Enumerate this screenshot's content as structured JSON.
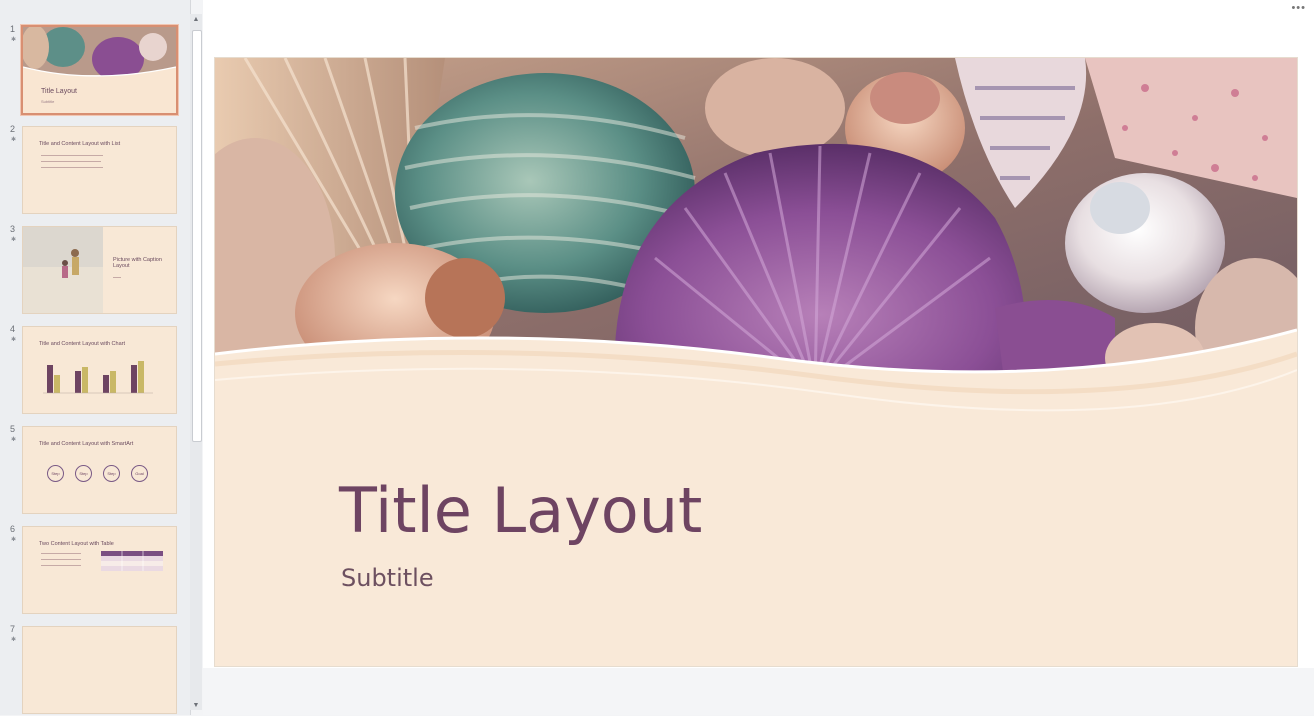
{
  "slides": [
    {
      "number": "1",
      "title": "Title Layout",
      "subtitle": "Subtitle"
    },
    {
      "number": "2",
      "title": "Title and Content Layout with List"
    },
    {
      "number": "3",
      "title": "Picture with Caption Layout"
    },
    {
      "number": "4",
      "title": "Title and Content Layout with Chart"
    },
    {
      "number": "5",
      "title": "Title and Content Layout with SmartArt",
      "smartart": [
        "Step",
        "Step",
        "Step",
        "Goal"
      ]
    },
    {
      "number": "6",
      "title": "Two Content Layout with Table"
    },
    {
      "number": "7",
      "title": ""
    }
  ],
  "current_slide": {
    "title": "Title Layout",
    "subtitle": "Subtitle"
  },
  "icons": {
    "more": "ellipsis-icon",
    "star": "animation-star-icon",
    "scroll_up": "scroll-up-icon",
    "scroll_down": "scroll-down-icon"
  },
  "colors": {
    "slide_background": "#f9e9d8",
    "title_color": "#6e4462",
    "selected_border": "#d88f72",
    "accent_purple": "#8a4e92"
  }
}
